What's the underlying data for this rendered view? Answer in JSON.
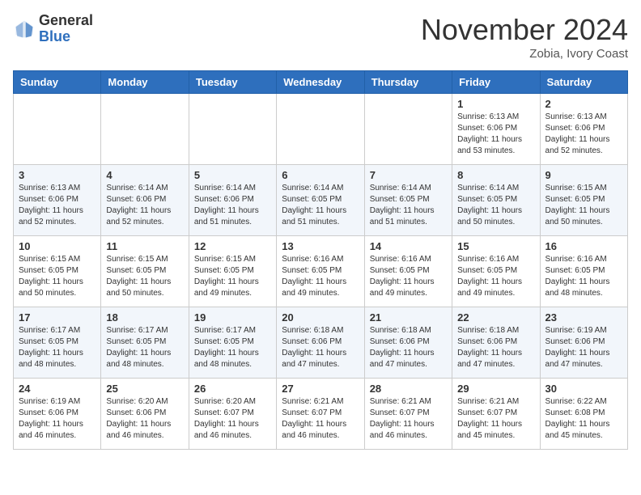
{
  "header": {
    "logo_general": "General",
    "logo_blue": "Blue",
    "month_title": "November 2024",
    "location": "Zobia, Ivory Coast"
  },
  "weekdays": [
    "Sunday",
    "Monday",
    "Tuesday",
    "Wednesday",
    "Thursday",
    "Friday",
    "Saturday"
  ],
  "weeks": [
    [
      {
        "day": "",
        "info": ""
      },
      {
        "day": "",
        "info": ""
      },
      {
        "day": "",
        "info": ""
      },
      {
        "day": "",
        "info": ""
      },
      {
        "day": "",
        "info": ""
      },
      {
        "day": "1",
        "info": "Sunrise: 6:13 AM\nSunset: 6:06 PM\nDaylight: 11 hours\nand 53 minutes."
      },
      {
        "day": "2",
        "info": "Sunrise: 6:13 AM\nSunset: 6:06 PM\nDaylight: 11 hours\nand 52 minutes."
      }
    ],
    [
      {
        "day": "3",
        "info": "Sunrise: 6:13 AM\nSunset: 6:06 PM\nDaylight: 11 hours\nand 52 minutes."
      },
      {
        "day": "4",
        "info": "Sunrise: 6:14 AM\nSunset: 6:06 PM\nDaylight: 11 hours\nand 52 minutes."
      },
      {
        "day": "5",
        "info": "Sunrise: 6:14 AM\nSunset: 6:06 PM\nDaylight: 11 hours\nand 51 minutes."
      },
      {
        "day": "6",
        "info": "Sunrise: 6:14 AM\nSunset: 6:05 PM\nDaylight: 11 hours\nand 51 minutes."
      },
      {
        "day": "7",
        "info": "Sunrise: 6:14 AM\nSunset: 6:05 PM\nDaylight: 11 hours\nand 51 minutes."
      },
      {
        "day": "8",
        "info": "Sunrise: 6:14 AM\nSunset: 6:05 PM\nDaylight: 11 hours\nand 50 minutes."
      },
      {
        "day": "9",
        "info": "Sunrise: 6:15 AM\nSunset: 6:05 PM\nDaylight: 11 hours\nand 50 minutes."
      }
    ],
    [
      {
        "day": "10",
        "info": "Sunrise: 6:15 AM\nSunset: 6:05 PM\nDaylight: 11 hours\nand 50 minutes."
      },
      {
        "day": "11",
        "info": "Sunrise: 6:15 AM\nSunset: 6:05 PM\nDaylight: 11 hours\nand 50 minutes."
      },
      {
        "day": "12",
        "info": "Sunrise: 6:15 AM\nSunset: 6:05 PM\nDaylight: 11 hours\nand 49 minutes."
      },
      {
        "day": "13",
        "info": "Sunrise: 6:16 AM\nSunset: 6:05 PM\nDaylight: 11 hours\nand 49 minutes."
      },
      {
        "day": "14",
        "info": "Sunrise: 6:16 AM\nSunset: 6:05 PM\nDaylight: 11 hours\nand 49 minutes."
      },
      {
        "day": "15",
        "info": "Sunrise: 6:16 AM\nSunset: 6:05 PM\nDaylight: 11 hours\nand 49 minutes."
      },
      {
        "day": "16",
        "info": "Sunrise: 6:16 AM\nSunset: 6:05 PM\nDaylight: 11 hours\nand 48 minutes."
      }
    ],
    [
      {
        "day": "17",
        "info": "Sunrise: 6:17 AM\nSunset: 6:05 PM\nDaylight: 11 hours\nand 48 minutes."
      },
      {
        "day": "18",
        "info": "Sunrise: 6:17 AM\nSunset: 6:05 PM\nDaylight: 11 hours\nand 48 minutes."
      },
      {
        "day": "19",
        "info": "Sunrise: 6:17 AM\nSunset: 6:05 PM\nDaylight: 11 hours\nand 48 minutes."
      },
      {
        "day": "20",
        "info": "Sunrise: 6:18 AM\nSunset: 6:06 PM\nDaylight: 11 hours\nand 47 minutes."
      },
      {
        "day": "21",
        "info": "Sunrise: 6:18 AM\nSunset: 6:06 PM\nDaylight: 11 hours\nand 47 minutes."
      },
      {
        "day": "22",
        "info": "Sunrise: 6:18 AM\nSunset: 6:06 PM\nDaylight: 11 hours\nand 47 minutes."
      },
      {
        "day": "23",
        "info": "Sunrise: 6:19 AM\nSunset: 6:06 PM\nDaylight: 11 hours\nand 47 minutes."
      }
    ],
    [
      {
        "day": "24",
        "info": "Sunrise: 6:19 AM\nSunset: 6:06 PM\nDaylight: 11 hours\nand 46 minutes."
      },
      {
        "day": "25",
        "info": "Sunrise: 6:20 AM\nSunset: 6:06 PM\nDaylight: 11 hours\nand 46 minutes."
      },
      {
        "day": "26",
        "info": "Sunrise: 6:20 AM\nSunset: 6:07 PM\nDaylight: 11 hours\nand 46 minutes."
      },
      {
        "day": "27",
        "info": "Sunrise: 6:21 AM\nSunset: 6:07 PM\nDaylight: 11 hours\nand 46 minutes."
      },
      {
        "day": "28",
        "info": "Sunrise: 6:21 AM\nSunset: 6:07 PM\nDaylight: 11 hours\nand 46 minutes."
      },
      {
        "day": "29",
        "info": "Sunrise: 6:21 AM\nSunset: 6:07 PM\nDaylight: 11 hours\nand 45 minutes."
      },
      {
        "day": "30",
        "info": "Sunrise: 6:22 AM\nSunset: 6:08 PM\nDaylight: 11 hours\nand 45 minutes."
      }
    ]
  ]
}
